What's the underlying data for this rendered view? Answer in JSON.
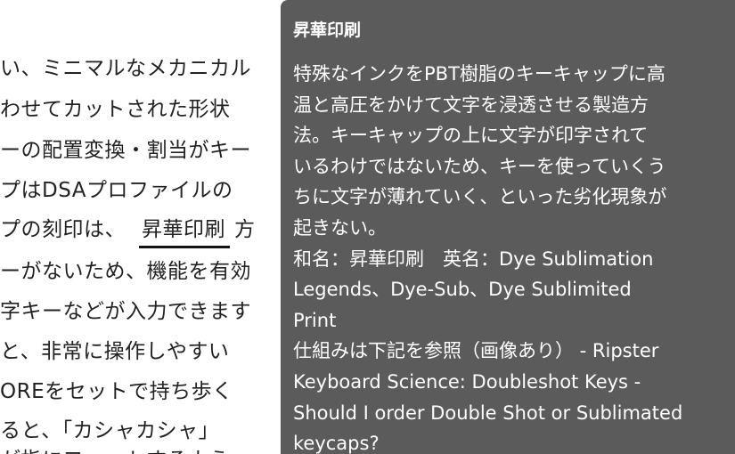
{
  "article": {
    "lines": [
      "い、ミニマルなメカニカル",
      "わせてカットされた形状",
      "ーの配置変換・割当がキー",
      "プはDSAプロファイルの",
      "プの刻印は、",
      "ーがないため、機能を有効",
      "字キーなどが入力できます",
      "と、非常に操作しやすい",
      "OREをセットで持ち歩く",
      "ると、「カシャカシャ」",
      "が指にフィットするよう"
    ],
    "highlighted_term": "昇華印刷",
    "term_suffix": "方"
  },
  "tooltip": {
    "title": "昇華印刷",
    "description_lines": [
      "特殊なインクをPBT樹脂のキーキャップに高",
      "温と高圧をかけて文字を浸透させる製造方",
      "法。キーキャップの上に文字が印字されて",
      "いるわけではないため、キーを使っていくう",
      "ちに文字が薄れていく、といった劣化現象が",
      "起きない。"
    ],
    "names_lines": [
      "和名：昇華印刷　英名：Dye Sublimation",
      "Legends、Dye-Sub、Dye Sublimited",
      "Print"
    ],
    "reference_lines": [
      "仕組みは下記を参照（画像あり） - Ripster",
      "Keyboard Science: Doubleshot Keys -",
      "Should I order Double Shot or Sublimated",
      "keycaps?"
    ]
  }
}
